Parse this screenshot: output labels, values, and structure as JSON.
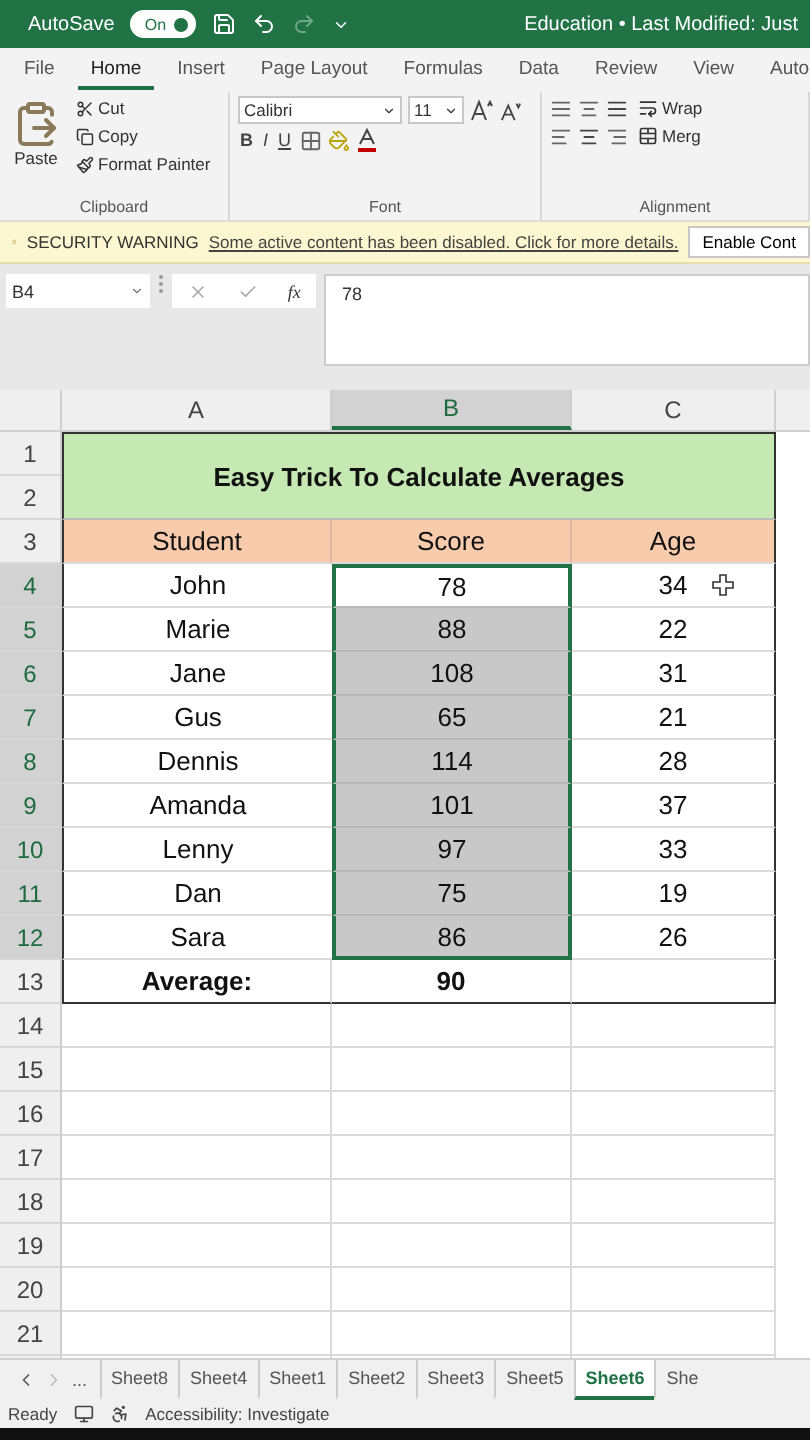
{
  "title_bar": {
    "autosave_label": "AutoSave",
    "autosave_toggle": {
      "label": "On",
      "on": true
    },
    "document_title": "Education • Last Modified: Just"
  },
  "menu_tabs": [
    {
      "label": "File",
      "selected": false
    },
    {
      "label": "Home",
      "selected": true
    },
    {
      "label": "Insert",
      "selected": false
    },
    {
      "label": "Page Layout",
      "selected": false
    },
    {
      "label": "Formulas",
      "selected": false
    },
    {
      "label": "Data",
      "selected": false
    },
    {
      "label": "Review",
      "selected": false
    },
    {
      "label": "View",
      "selected": false
    },
    {
      "label": "Auto",
      "selected": false
    }
  ],
  "ribbon": {
    "clipboard": {
      "paste": "Paste",
      "cut": "Cut",
      "copy": "Copy",
      "format_painter": "Format Painter",
      "group_label": "Clipboard"
    },
    "font": {
      "font_name": "Calibri",
      "font_size": "11",
      "bold": "B",
      "italic": "I",
      "underline": "U",
      "group_label": "Font"
    },
    "alignment": {
      "wrap": "Wrap",
      "merge": "Merg",
      "group_label": "Alignment"
    }
  },
  "security_bar": {
    "title": "SECURITY WARNING",
    "message": "Some active content has been disabled. Click for more details.",
    "button": "Enable Cont"
  },
  "formula_bar": {
    "name_box": "B4",
    "function_button": "fx",
    "formula": "78"
  },
  "grid": {
    "columns": [
      {
        "label": "A",
        "selected": false
      },
      {
        "label": "B",
        "selected": true
      },
      {
        "label": "C",
        "selected": false
      }
    ],
    "row_numbers": [
      {
        "label": "1",
        "selected": false
      },
      {
        "label": "2",
        "selected": false
      },
      {
        "label": "3",
        "selected": false
      },
      {
        "label": "4",
        "selected": true
      },
      {
        "label": "5",
        "selected": true
      },
      {
        "label": "6",
        "selected": true
      },
      {
        "label": "7",
        "selected": true
      },
      {
        "label": "8",
        "selected": true
      },
      {
        "label": "9",
        "selected": true
      },
      {
        "label": "10",
        "selected": true
      },
      {
        "label": "11",
        "selected": true
      },
      {
        "label": "12",
        "selected": true
      },
      {
        "label": "13",
        "selected": false
      },
      {
        "label": "14",
        "selected": false
      },
      {
        "label": "15",
        "selected": false
      },
      {
        "label": "16",
        "selected": false
      },
      {
        "label": "17",
        "selected": false
      },
      {
        "label": "18",
        "selected": false
      },
      {
        "label": "19",
        "selected": false
      },
      {
        "label": "20",
        "selected": false
      },
      {
        "label": "21",
        "selected": false
      }
    ]
  },
  "table": {
    "title": "Easy Trick To Calculate Averages",
    "headers": [
      "Student",
      "Score",
      "Age"
    ],
    "rows": [
      {
        "student": "John",
        "score": "78",
        "age": "34",
        "selected": true,
        "active": true
      },
      {
        "student": "Marie",
        "score": "88",
        "age": "22",
        "selected": true,
        "active": false
      },
      {
        "student": "Jane",
        "score": "108",
        "age": "31",
        "selected": true,
        "active": false
      },
      {
        "student": "Gus",
        "score": "65",
        "age": "21",
        "selected": true,
        "active": false
      },
      {
        "student": "Dennis",
        "score": "114",
        "age": "28",
        "selected": true,
        "active": false
      },
      {
        "student": "Amanda",
        "score": "101",
        "age": "37",
        "selected": true,
        "active": false
      },
      {
        "student": "Lenny",
        "score": "97",
        "age": "33",
        "selected": true,
        "active": false
      },
      {
        "student": "Dan",
        "score": "75",
        "age": "19",
        "selected": true,
        "active": false
      },
      {
        "student": "Sara",
        "score": "86",
        "age": "26",
        "selected": true,
        "active": false
      }
    ],
    "average": {
      "label": "Average:",
      "value": "90"
    }
  },
  "sheet_tabs": {
    "more": "...",
    "tabs": [
      {
        "label": "Sheet8",
        "selected": false
      },
      {
        "label": "Sheet4",
        "selected": false
      },
      {
        "label": "Sheet1",
        "selected": false
      },
      {
        "label": "Sheet2",
        "selected": false
      },
      {
        "label": "Sheet3",
        "selected": false
      },
      {
        "label": "Sheet5",
        "selected": false
      },
      {
        "label": "Sheet6",
        "selected": true
      },
      {
        "label": "She",
        "selected": false
      }
    ]
  },
  "status_bar": {
    "status": "Ready",
    "accessibility": "Accessibility: Investigate"
  }
}
